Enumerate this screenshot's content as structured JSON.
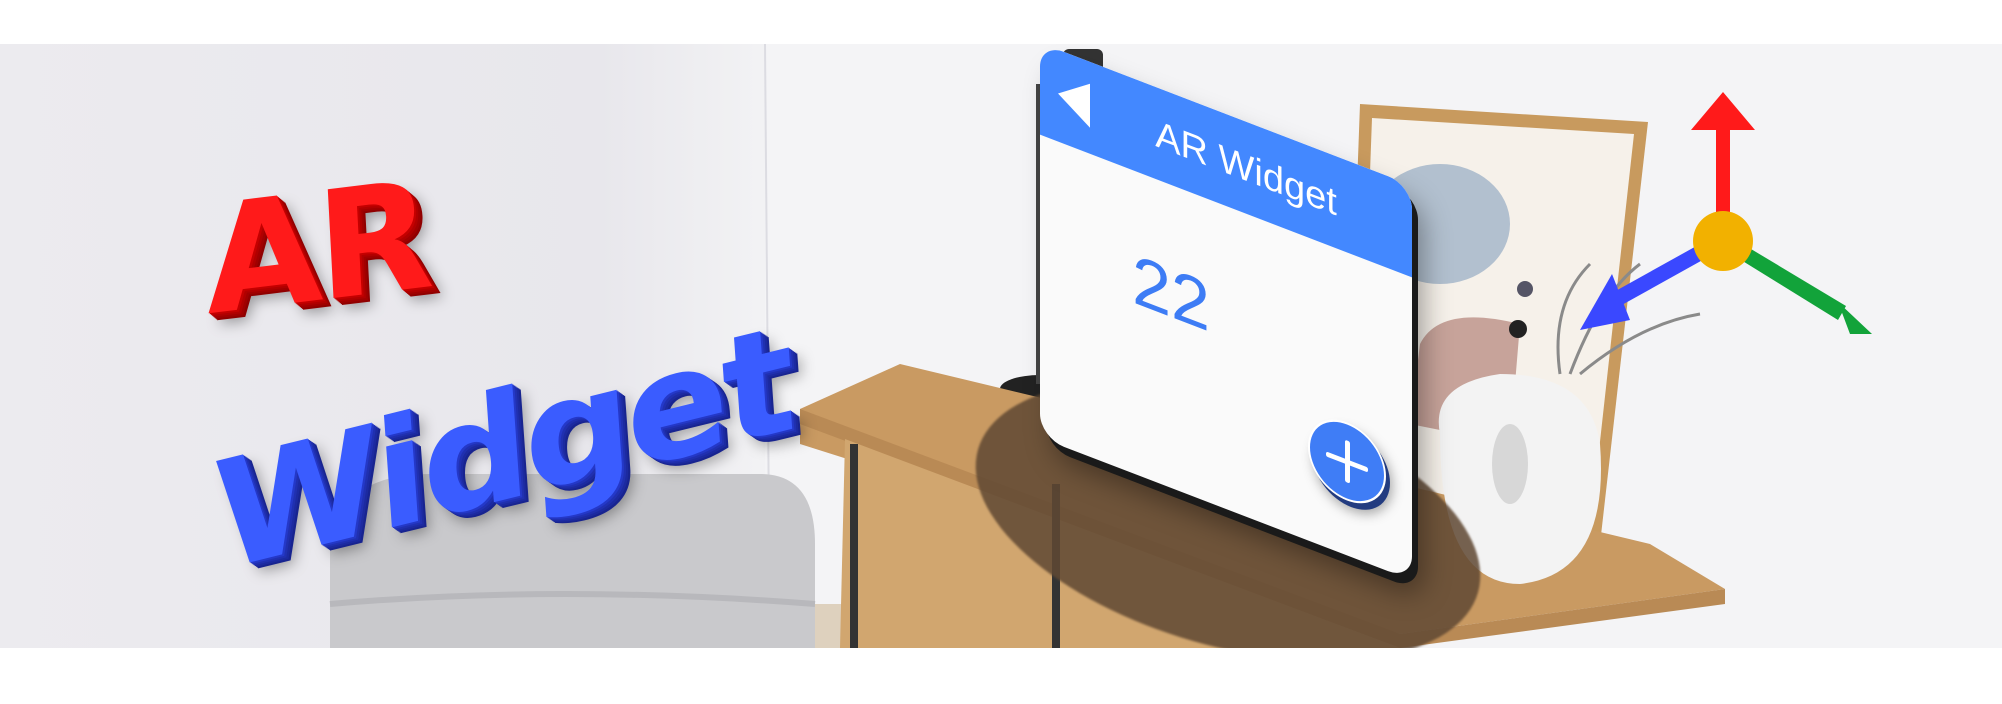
{
  "hero": {
    "line1": "AR",
    "line2": "Widget",
    "line1_color": "#ff1a1a",
    "line2_color": "#3a5cff"
  },
  "widget": {
    "title": "AR Widget",
    "counter": "22",
    "header_color": "#4388ff",
    "back_icon": "back-triangle-icon",
    "add_icon": "plus-icon"
  },
  "gizmo": {
    "axis_colors": {
      "up": "#ff1a1a",
      "left": "#3a48ff",
      "right": "#12a33a",
      "center": "#f2b100"
    }
  }
}
